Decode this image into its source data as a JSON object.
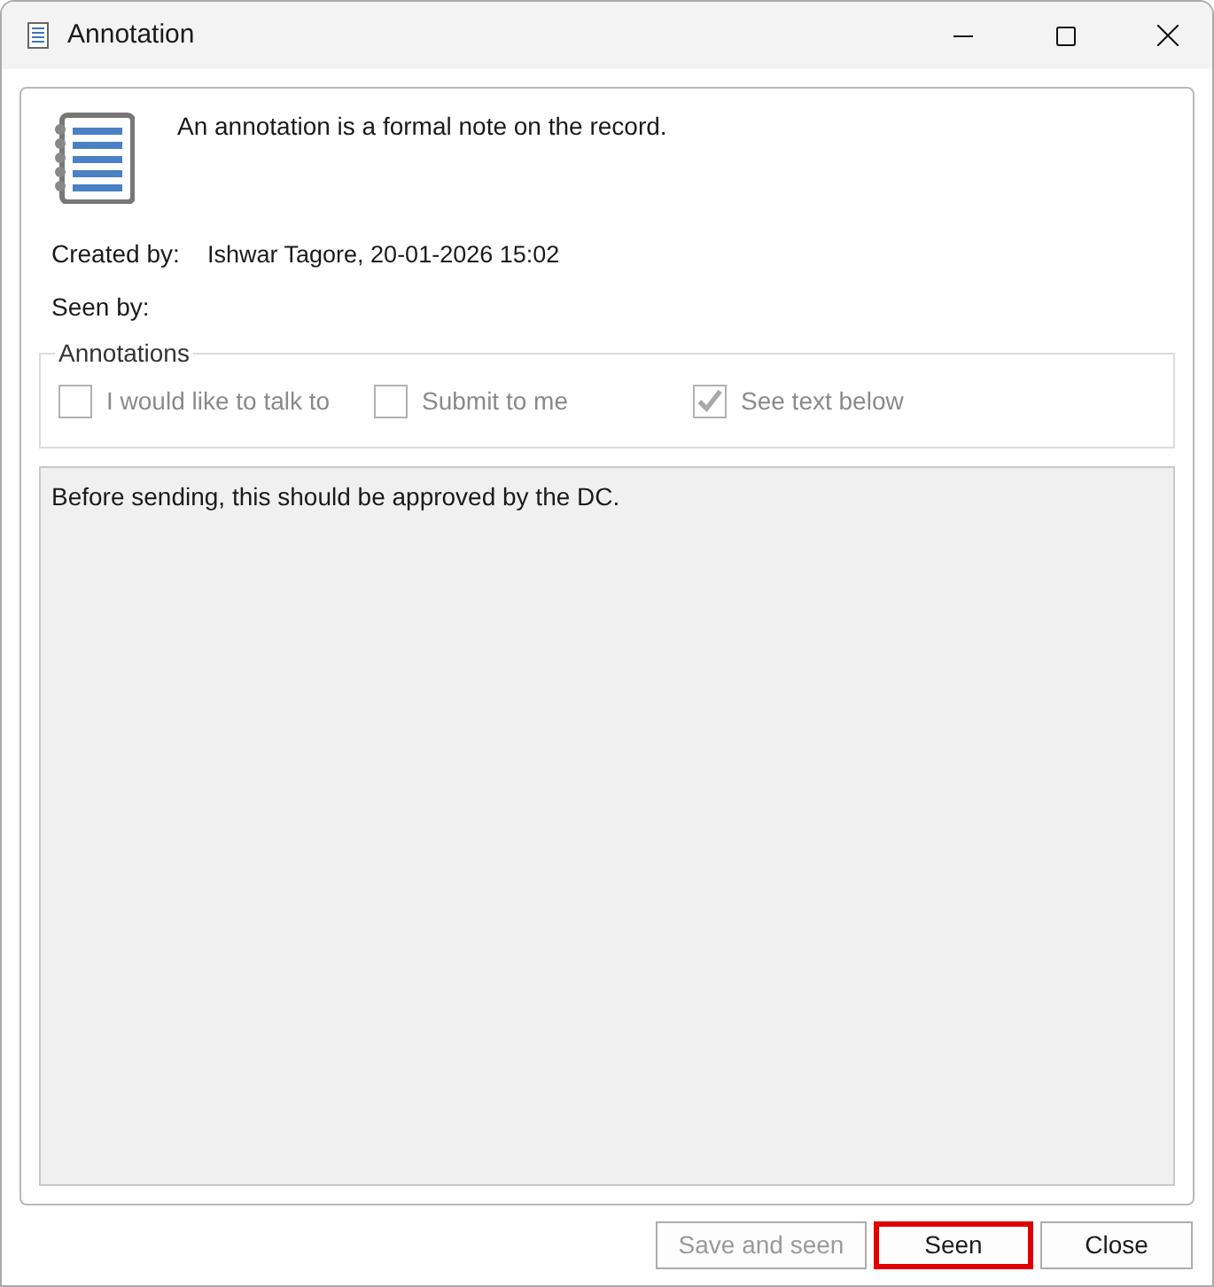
{
  "window": {
    "title": "Annotation"
  },
  "message": "An annotation is a formal note on the record.",
  "fields": [
    {
      "label": "Created by:",
      "value": "Ishwar Tagore, 20-01-2026 15:02"
    },
    {
      "label": "Seen by:"
    }
  ],
  "annotations": {
    "title": "Annotations",
    "options": [
      {
        "label": "I would like to talk to",
        "checked": false,
        "disabled": true
      },
      {
        "label": "Submit to me",
        "checked": false,
        "disabled": true
      },
      {
        "label": "See text below",
        "checked": true,
        "disabled": true
      }
    ]
  },
  "text": "Before sending, this should be approved by the DC.",
  "buttons": [
    {
      "label": "Save and seen",
      "disabled": true,
      "focused": false
    },
    {
      "label": "Seen",
      "disabled": false,
      "focused": true
    },
    {
      "label": "Close",
      "disabled": false,
      "focused": false
    }
  ]
}
